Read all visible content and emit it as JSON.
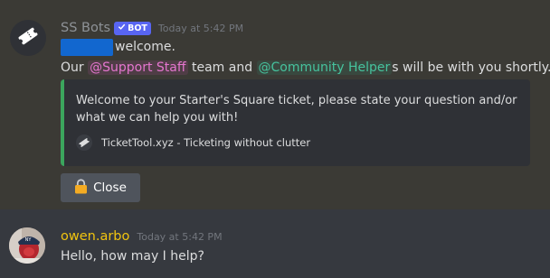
{
  "message1": {
    "author": "SS Bots",
    "bot_tag": "BOT",
    "timestamp": "Today at 5:42 PM",
    "line1_text": "welcome.",
    "line2": {
      "prefix": "Our ",
      "mention_support": "@Support Staff",
      "middle": " team and ",
      "mention_helper": "@Community Helper",
      "suffix": "s will be with you shortly."
    },
    "embed": {
      "description": "Welcome to your Starter's Square ticket, please state your question and/or what we can help you with!",
      "footer": "TicketTool.xyz - Ticketing without clutter",
      "accent_color": "#3ba55d"
    },
    "close_button_label": "Close"
  },
  "message2": {
    "author": "owen.arbo",
    "timestamp": "Today at 5:42 PM",
    "text": "Hello, how may I help?"
  },
  "icons": {
    "bot_avatar": "ticket-icon",
    "bot_tag": "checkmark-icon",
    "footer": "ticket-icon",
    "close_button": "lock-icon"
  },
  "colors": {
    "user_name": "#f1c40f",
    "mention_support": "#e576cf",
    "mention_helper": "#46c39e",
    "bot_tag": "#5865f2"
  }
}
